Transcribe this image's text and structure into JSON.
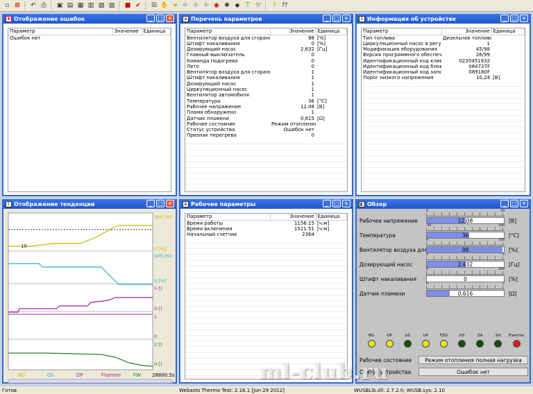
{
  "errors_window": {
    "title": "Отображение ошибок",
    "col_param": "Параметр",
    "col_value": "Значение",
    "col_unit": "Единица",
    "rows": [
      {
        "p": "Ошибок нет",
        "v": "",
        "u": ""
      }
    ]
  },
  "params_window": {
    "title": "Перечень параметров",
    "col_param": "Параметр",
    "col_value": "Значение",
    "col_unit": "Единица",
    "rows": [
      {
        "p": "Вентилятор воздуха для сгорания...",
        "v": "98",
        "u": "[%]"
      },
      {
        "p": "Штифт накаливания",
        "v": "0",
        "u": "[%]"
      },
      {
        "p": "Дозирующий насос",
        "v": "2,632",
        "u": "[Гц]"
      },
      {
        "p": "Главный выключатель",
        "v": "0",
        "u": ""
      },
      {
        "p": "Команда подогрева",
        "v": "0",
        "u": ""
      },
      {
        "p": "Лето",
        "v": "0",
        "u": ""
      },
      {
        "p": "Вентилятор воздуха для сгорания...",
        "v": "1",
        "u": ""
      },
      {
        "p": "Штифт накаливания",
        "v": "1",
        "u": ""
      },
      {
        "p": "Дозирующий насос",
        "v": "1",
        "u": ""
      },
      {
        "p": "Циркуляционный насос",
        "v": "1",
        "u": ""
      },
      {
        "p": "Вентилятор автомобиля",
        "v": "1",
        "u": ""
      },
      {
        "p": "Температура",
        "v": "36",
        "u": "[°C]"
      },
      {
        "p": "Рабочее напряжение",
        "v": "12,08",
        "u": "[В]"
      },
      {
        "p": "Пламя обнаружено",
        "v": "1",
        "u": ""
      },
      {
        "p": "Датчик пламени",
        "v": "0,615",
        "u": "[Ω]"
      },
      {
        "p": "Рабочее состояние",
        "v": "Режим отопления ...",
        "u": ""
      },
      {
        "p": "Статус устройства",
        "v": "Ошибок нет",
        "u": ""
      },
      {
        "p": "Признак перегрева",
        "v": "0",
        "u": ""
      }
    ]
  },
  "info_window": {
    "title": "Информация об устройстве",
    "col_param": "Параметр",
    "col_value": "Значение",
    "col_unit": "Единица",
    "rows": [
      {
        "p": "Тип топлива",
        "v": "Дизельное топливо",
        "u": ""
      },
      {
        "p": "Циркуляционный насос в регулир...",
        "v": "1",
        "u": ""
      },
      {
        "p": "Модификация оборудования",
        "v": "45/98",
        "u": ""
      },
      {
        "p": "Версия программного обеспечения",
        "v": "26/99",
        "u": ""
      },
      {
        "p": "Идентификационный код клиента",
        "v": "0235451932",
        "u": ""
      },
      {
        "p": "Идентификационный код блока у...",
        "v": "084727F",
        "u": ""
      },
      {
        "p": "Идентификационный код записи д...",
        "v": "089180F",
        "u": ""
      },
      {
        "p": "Порог низкого напряжения",
        "v": "10,24",
        "u": "[В]"
      }
    ]
  },
  "trend_window": {
    "title": "Отображение тенденции",
    "axis_labels": [
      "100 [%]",
      "0 [%]",
      "100 [%]",
      "0 [%]",
      "5 []",
      "0 []",
      "1",
      "0",
      "2 []",
      "0 []"
    ],
    "left_label": "16",
    "legend": [
      {
        "name": "BG",
        "color": "#c8b400"
      },
      {
        "name": "GS",
        "color": "#2bb3c0"
      },
      {
        "name": "DP",
        "color": "#a020a0"
      },
      {
        "name": "Flamme",
        "color": "#a020a0"
      },
      {
        "name": "FW",
        "color": "#208020"
      }
    ],
    "time": "28800.5s"
  },
  "work_window": {
    "title": "Рабочие параметры",
    "col_param": "Параметр",
    "col_value": "Значение",
    "col_unit": "Единица",
    "rows": [
      {
        "p": "Время работы",
        "v": "1156:15",
        "u": "[ч:м]"
      },
      {
        "p": "Время включения",
        "v": "1521:51",
        "u": "[ч:м]"
      },
      {
        "p": "Начальный счетчик",
        "v": "2364",
        "u": ""
      }
    ]
  },
  "overview_window": {
    "title": "Обзор",
    "gauges": [
      {
        "label": "Рабочее напряжение",
        "value": "12,08",
        "unit": "[В]",
        "fill": 0.5,
        "scale_min": "0",
        "scale_max": "20"
      },
      {
        "label": "Температура",
        "value": "36",
        "unit": "[°C]",
        "fill": 0.55,
        "scale_min": "-40",
        "scale_max": "100"
      },
      {
        "label": "Вентилятор воздуха для",
        "value": "98",
        "unit": "[%]",
        "fill": 0.98,
        "scale_min": "0",
        "scale_max": "100"
      },
      {
        "label": "Дозирующий насос",
        "value": "2,632",
        "unit": "[Гц]",
        "fill": 0.5,
        "scale_min": "0",
        "scale_max": "5"
      },
      {
        "label": "Штифт накаливания",
        "value": "0",
        "unit": "[%]",
        "fill": 0,
        "scale_min": "0",
        "scale_max": "100"
      },
      {
        "label": "Датчик пламени",
        "value": "0,616",
        "unit": "[Ω]",
        "fill": 0.3,
        "scale_min": "0",
        "scale_max": "2"
      }
    ],
    "leds": [
      {
        "name": "BG",
        "color": "#f0e020"
      },
      {
        "name": "DP",
        "color": "#f0e020"
      },
      {
        "name": "GS",
        "color": "#1b4a1b"
      },
      {
        "name": "UP",
        "color": "#f0e020"
      },
      {
        "name": "FZG",
        "color": "#f0e020"
      },
      {
        "name": "HS",
        "color": "#1b4a1b"
      },
      {
        "name": "ZA",
        "color": "#1b4a1b"
      },
      {
        "name": "SO",
        "color": "#1b4a1b"
      },
      {
        "name": "Flamme",
        "color": "#e02020"
      }
    ],
    "state_label": "Рабочее состояние",
    "state_value": "Режим отопления полная нагрузка",
    "status_label": "Статус устройства",
    "status_value": "Ошибок нет"
  },
  "statusbar": {
    "left": "Готов",
    "center": "Webasto Thermo Test: 2.16.1 [Jun 29 2012]",
    "right": "WUSBLib.dll: 2.7.2.0; WUSB.sys: 2.10"
  },
  "watermark": "ml-club.ru"
}
